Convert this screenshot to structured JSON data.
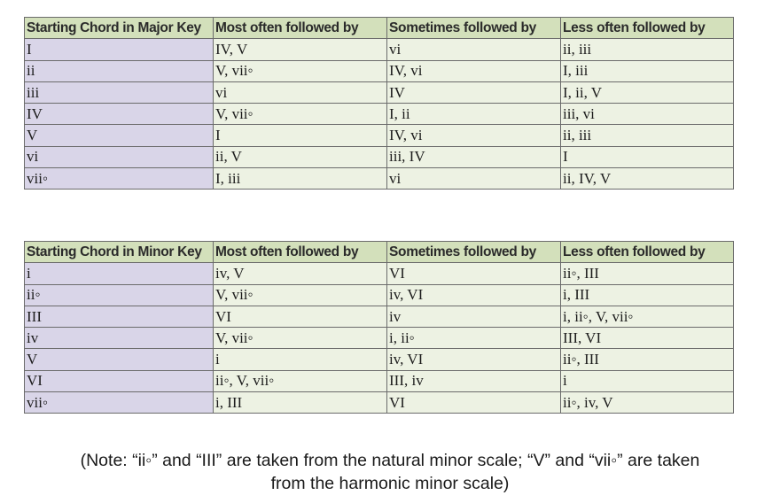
{
  "major_table": {
    "headers": [
      "Starting Chord in Major Key",
      "Most often followed by",
      "Sometimes followed by",
      "Less often followed by"
    ],
    "rows": [
      [
        "I",
        "IV, V",
        "vi",
        "ii, iii"
      ],
      [
        "ii",
        "V, vii◦",
        "IV, vi",
        "I, iii"
      ],
      [
        "iii",
        "vi",
        "IV",
        "I, ii, V"
      ],
      [
        "IV",
        "V, vii◦",
        "I, ii",
        "iii, vi"
      ],
      [
        "V",
        "I",
        "IV, vi",
        "ii, iii"
      ],
      [
        "vi",
        "ii, V",
        "iii, IV",
        "I"
      ],
      [
        "vii◦",
        "I, iii",
        "vi",
        "ii, IV, V"
      ]
    ]
  },
  "minor_table": {
    "headers": [
      "Starting Chord in Minor Key",
      "Most often followed by",
      "Sometimes followed by",
      "Less often followed by"
    ],
    "rows": [
      [
        "i",
        "iv, V",
        "VI",
        "ii◦, III"
      ],
      [
        "ii◦",
        "V, vii◦",
        "iv, VI",
        "i, III"
      ],
      [
        "III",
        "VI",
        "iv",
        "i, ii◦, V, vii◦"
      ],
      [
        "iv",
        "V, vii◦",
        "i, ii◦",
        "III, VI"
      ],
      [
        "V",
        "i",
        "iv, VI",
        "ii◦, III"
      ],
      [
        "VI",
        "ii◦, V, vii◦",
        "III, iv",
        "i"
      ],
      [
        "vii◦",
        "i, III",
        "VI",
        "ii◦, iv, V"
      ]
    ]
  },
  "note": {
    "line1": "(Note: “ii◦” and “III” are taken from the natural minor scale; “V” and “vii◦” are taken",
    "line2": "from the harmonic minor scale)"
  },
  "colors": {
    "header_bg": "#d3e0bb",
    "first_column_bg": "#d9d5e8",
    "cell_bg": "#edf2e3",
    "border": "#6b6b6b"
  }
}
